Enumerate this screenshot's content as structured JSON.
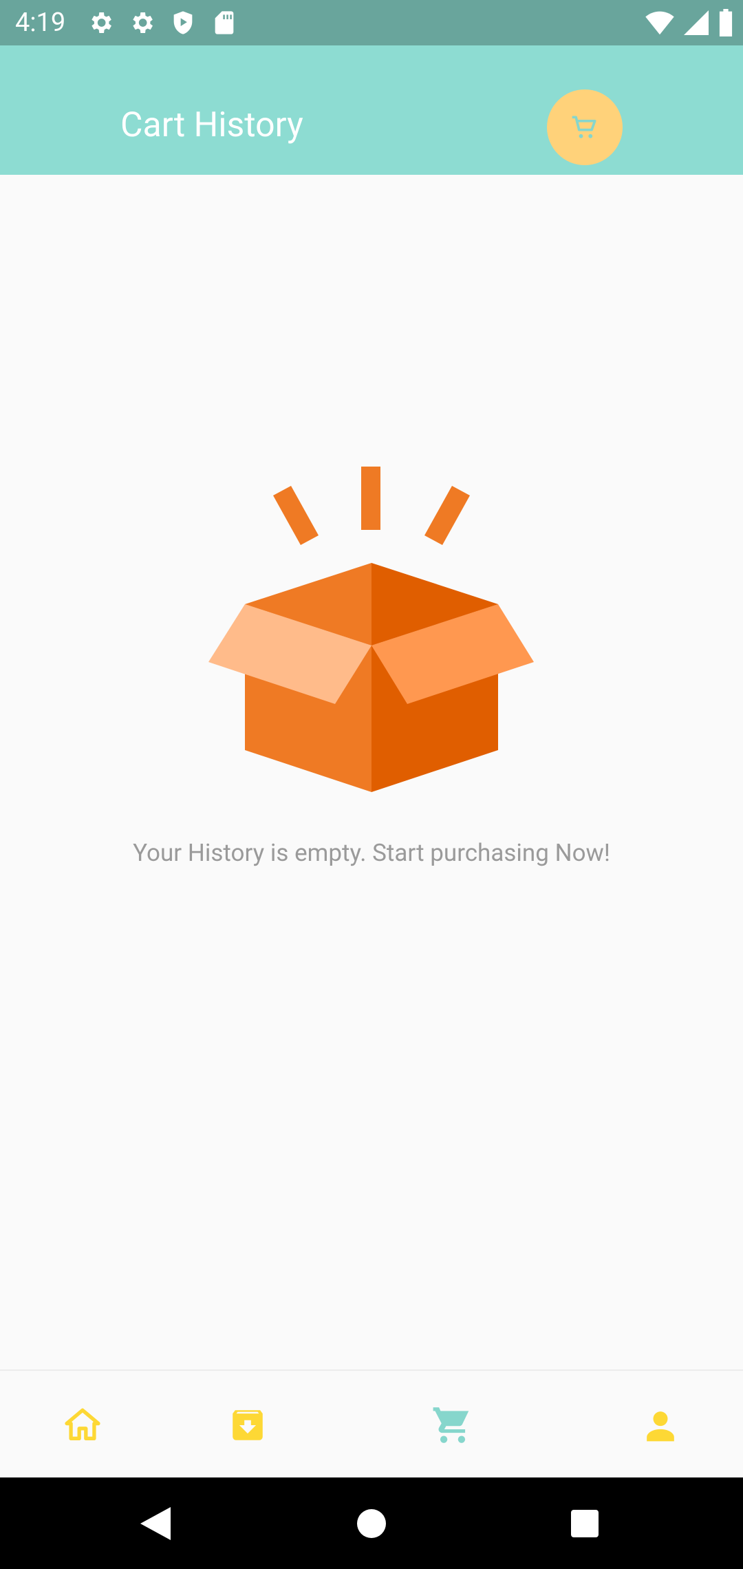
{
  "status_bar": {
    "time": "4:19",
    "left_icons": [
      "settings-icon",
      "settings-icon",
      "shield-play-icon",
      "sd-card-icon"
    ],
    "right_icons": [
      "wifi-icon",
      "cell-signal-icon",
      "battery-icon"
    ]
  },
  "app_bar": {
    "title": "Cart History",
    "action_icon": "cart-icon",
    "colors": {
      "bar": "#8ddcd2",
      "fab": "#ffd27a",
      "fab_icon": "#86d6cc"
    }
  },
  "empty_state": {
    "illustration": "open-box-icon",
    "message": "Your History is empty. Start purchasing Now!",
    "colors": {
      "box_light": "#ef7a24",
      "box_dark": "#e05e00",
      "flap_light": "#ffbb8a",
      "flap_mid": "#ff9850"
    }
  },
  "bottom_nav": {
    "items": [
      {
        "icon": "home-icon",
        "active": false
      },
      {
        "icon": "archive-download-icon",
        "active": false
      },
      {
        "icon": "cart-icon",
        "active": true
      },
      {
        "icon": "person-icon",
        "active": false
      }
    ],
    "colors": {
      "inactive": "#fdd835",
      "active": "#86d6cc"
    }
  },
  "system_nav": [
    "back-icon",
    "home-circle-icon",
    "recents-icon"
  ]
}
